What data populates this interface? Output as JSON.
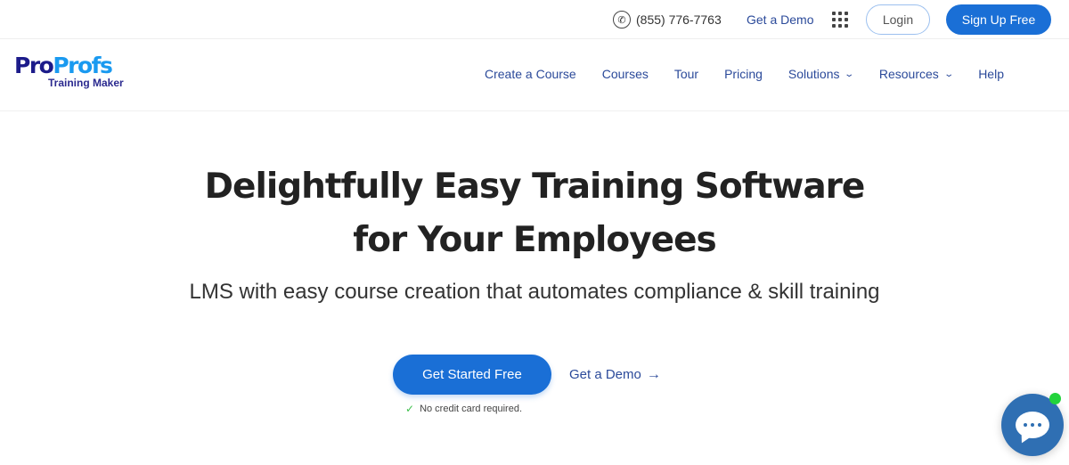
{
  "topbar": {
    "phone": "(855) 776-7763",
    "phone_icon": "phone-icon",
    "demo_link": "Get a Demo",
    "apps_icon": "grid-icon",
    "login_label": "Login",
    "signup_label": "Sign Up Free"
  },
  "logo": {
    "part1": "Pro",
    "part2": "Profs",
    "subtitle": "Training Maker"
  },
  "nav": {
    "items": [
      {
        "label": "Create a Course"
      },
      {
        "label": "Courses"
      },
      {
        "label": "Tour"
      },
      {
        "label": "Pricing"
      },
      {
        "label": "Solutions",
        "dropdown": true
      },
      {
        "label": "Resources",
        "dropdown": true
      },
      {
        "label": "Help"
      }
    ]
  },
  "hero": {
    "title_line1": "Delightfully Easy Training Software",
    "title_line2": "for Your Employees",
    "subtitle": "LMS with easy course creation that automates compliance & skill training",
    "cta_primary": "Get Started Free",
    "cta_secondary": "Get a Demo",
    "arrow": "→",
    "note": "No credit card required.",
    "check": "✓"
  },
  "chat": {
    "icon": "chat-bubble-icon",
    "status": "online"
  },
  "colors": {
    "primary": "#1a6fd6",
    "nav_text": "#2b4a9a",
    "logo_dark": "#1c1b8a",
    "logo_light": "#1a9af0",
    "chat": "#2f6fb3",
    "online": "#22d33b"
  }
}
